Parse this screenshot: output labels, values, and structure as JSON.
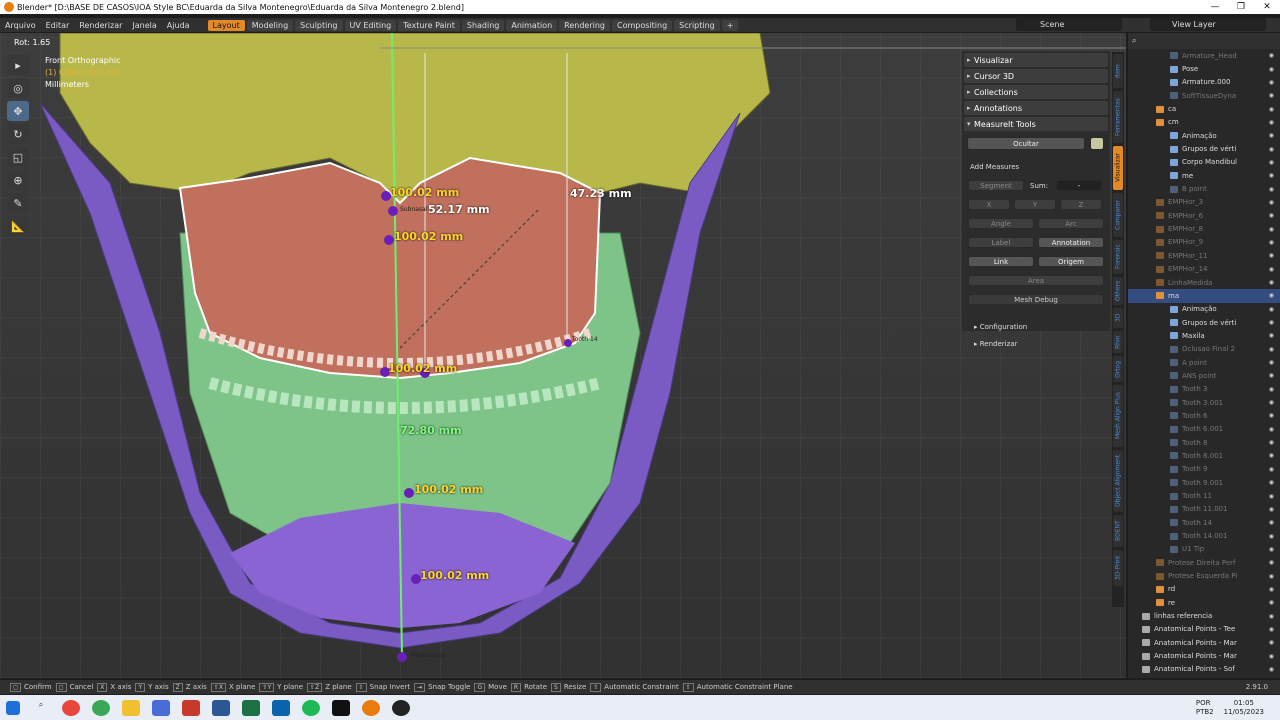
{
  "window": {
    "title": "Blender* [D:\\BASE DE CASOS\\IOA Style BC\\Eduarda da Silva Montenegro\\Eduarda da Silva Montenegro 2.blend]",
    "controls": [
      "—",
      "❐",
      "✕"
    ]
  },
  "menu": {
    "items": [
      "Arquivo",
      "Editar",
      "Renderizar",
      "Janela",
      "Ajuda"
    ],
    "workspaces": [
      "Layout",
      "Modeling",
      "Sculpting",
      "UV Editing",
      "Texture Paint",
      "Shading",
      "Animation",
      "Rendering",
      "Compositing",
      "Scripting"
    ],
    "active_workspace": "Layout",
    "add_workspace": "+",
    "scene": "Scene",
    "view_layer": "View Layer"
  },
  "viewport": {
    "rot": "Rot: 1.65",
    "view_name": "Front Orthographic",
    "collection": "(1) Collection | ma",
    "units": "Millimeters",
    "measures": [
      "100.02 mm",
      "52.17 mm",
      "47.23 mm",
      "100.02 mm",
      "100.02 mm",
      "72.80 mm",
      "100.02 mm",
      "100.02 mm"
    ],
    "point_labels": [
      "Subnasal",
      "Tooth 14",
      "Mentoniano"
    ]
  },
  "npanel": {
    "headers": [
      "Visualizar",
      "Cursor 3D",
      "Collections",
      "Annotations",
      "MeasureIt Tools"
    ],
    "hide_button": "Ocultar",
    "add_measures": "Add Measures",
    "buttons": {
      "segment": "Segment",
      "sum": "Sum:",
      "sum_value": "-",
      "x": "X",
      "y": "Y",
      "z": "Z",
      "angle": "Angle",
      "arc": "Arc",
      "label": "Label",
      "annotation": "Annotation",
      "link": "Link",
      "origin": "Origem",
      "area": "Area"
    },
    "mesh_debug": "Mesh Debug",
    "configuration": "Configuration",
    "render": "Renderizar"
  },
  "tabs": [
    "Item",
    "Ferramentas",
    "Visualizar",
    "Comparar",
    "Forensic",
    "Others",
    "3D",
    "Rhin",
    "Ortog",
    "Mesh Align Plus",
    "Object Alignment",
    "BDENT",
    "3D-Print"
  ],
  "active_tab": "Visualizar",
  "outliner": {
    "rows": [
      {
        "label": "Armature_Head",
        "indent": 3,
        "dim": true
      },
      {
        "label": "Pose",
        "indent": 3,
        "dim": false
      },
      {
        "label": "Armature.000",
        "indent": 3,
        "dim": false
      },
      {
        "label": "SoftTissueDyna",
        "indent": 3,
        "dim": true
      },
      {
        "label": "ca",
        "indent": 2,
        "dim": false
      },
      {
        "label": "cm",
        "indent": 2,
        "dim": false
      },
      {
        "label": "Animação",
        "indent": 3,
        "dim": false
      },
      {
        "label": "Grupos de vérti",
        "indent": 3,
        "dim": false
      },
      {
        "label": "Corpo Mandibul",
        "indent": 3,
        "dim": false
      },
      {
        "label": "me",
        "indent": 3,
        "dim": false
      },
      {
        "label": "B point",
        "indent": 3,
        "dim": true
      },
      {
        "label": "EMPHor_3",
        "indent": 2,
        "dim": true
      },
      {
        "label": "EMPHor_6",
        "indent": 2,
        "dim": true
      },
      {
        "label": "EMPHor_8",
        "indent": 2,
        "dim": true
      },
      {
        "label": "EMPHor_9",
        "indent": 2,
        "dim": true
      },
      {
        "label": "EMPHor_11",
        "indent": 2,
        "dim": true
      },
      {
        "label": "EMPHor_14",
        "indent": 2,
        "dim": true
      },
      {
        "label": "LinhaMedida",
        "indent": 2,
        "dim": true
      },
      {
        "label": "ma",
        "indent": 2,
        "dim": false,
        "selected": true
      },
      {
        "label": "Animação",
        "indent": 3,
        "dim": false
      },
      {
        "label": "Grupos de vérti",
        "indent": 3,
        "dim": false
      },
      {
        "label": "Maxila",
        "indent": 3,
        "dim": false
      },
      {
        "label": "Oclusao Final 2",
        "indent": 3,
        "dim": true
      },
      {
        "label": "A point",
        "indent": 3,
        "dim": true
      },
      {
        "label": "ANS point",
        "indent": 3,
        "dim": true
      },
      {
        "label": "Tooth 3",
        "indent": 3,
        "dim": true
      },
      {
        "label": "Tooth 3.001",
        "indent": 3,
        "dim": true
      },
      {
        "label": "Tooth 6",
        "indent": 3,
        "dim": true
      },
      {
        "label": "Tooth 6.001",
        "indent": 3,
        "dim": true
      },
      {
        "label": "Tooth 8",
        "indent": 3,
        "dim": true
      },
      {
        "label": "Tooth 8.001",
        "indent": 3,
        "dim": true
      },
      {
        "label": "Tooth 9",
        "indent": 3,
        "dim": true
      },
      {
        "label": "Tooth 9.001",
        "indent": 3,
        "dim": true
      },
      {
        "label": "Tooth 11",
        "indent": 3,
        "dim": true
      },
      {
        "label": "Tooth 11.001",
        "indent": 3,
        "dim": true
      },
      {
        "label": "Tooth 14",
        "indent": 3,
        "dim": true
      },
      {
        "label": "Tooth 14.001",
        "indent": 3,
        "dim": true
      },
      {
        "label": "U1 Tip",
        "indent": 3,
        "dim": true
      },
      {
        "label": "Protese Direita Perf",
        "indent": 2,
        "dim": true
      },
      {
        "label": "Protese Esquerda Pi",
        "indent": 2,
        "dim": true
      },
      {
        "label": "rd",
        "indent": 2,
        "dim": false
      },
      {
        "label": "re",
        "indent": 2,
        "dim": false
      },
      {
        "label": "linhas referencia",
        "indent": 1,
        "dim": false
      },
      {
        "label": "Anatomical Points - Tee",
        "indent": 1,
        "dim": false
      },
      {
        "label": "Anatomical Points - Mar",
        "indent": 1,
        "dim": false
      },
      {
        "label": "Anatomical Points - Mar",
        "indent": 1,
        "dim": false
      },
      {
        "label": "Anatomical Points - Sof",
        "indent": 1,
        "dim": false
      }
    ]
  },
  "status": {
    "items": [
      {
        "key": "◻",
        "label": "Confirm"
      },
      {
        "key": "◻",
        "label": "Cancel"
      },
      {
        "key": "X",
        "label": "X axis"
      },
      {
        "key": "Y",
        "label": "Y axis"
      },
      {
        "key": "Z",
        "label": "Z axis"
      },
      {
        "key": "⇧X",
        "label": "X plane"
      },
      {
        "key": "⇧Y",
        "label": "Y plane"
      },
      {
        "key": "⇧Z",
        "label": "Z plane"
      },
      {
        "key": "⇧",
        "label": "Snap Invert"
      },
      {
        "key": "⇥",
        "label": "Snap Toggle"
      },
      {
        "key": "G",
        "label": "Move"
      },
      {
        "key": "R",
        "label": "Rotate"
      },
      {
        "key": "S",
        "label": "Resize"
      },
      {
        "key": "⇧",
        "label": "Automatic Constraint"
      },
      {
        "key": "⇧",
        "label": "Automatic Constraint Plane"
      }
    ],
    "version": "2.91.0"
  },
  "taskbar": {
    "lang": "POR",
    "layout": "PTB2",
    "time": "01:05",
    "date": "11/05/2023"
  },
  "colors": {
    "accent": "#e38a26",
    "skull": "#b8b84a",
    "maxilla": "#c0705c",
    "mandible_green": "#7ec488",
    "mandible_purple": "#7a5bc4",
    "selection": "#334d80"
  }
}
